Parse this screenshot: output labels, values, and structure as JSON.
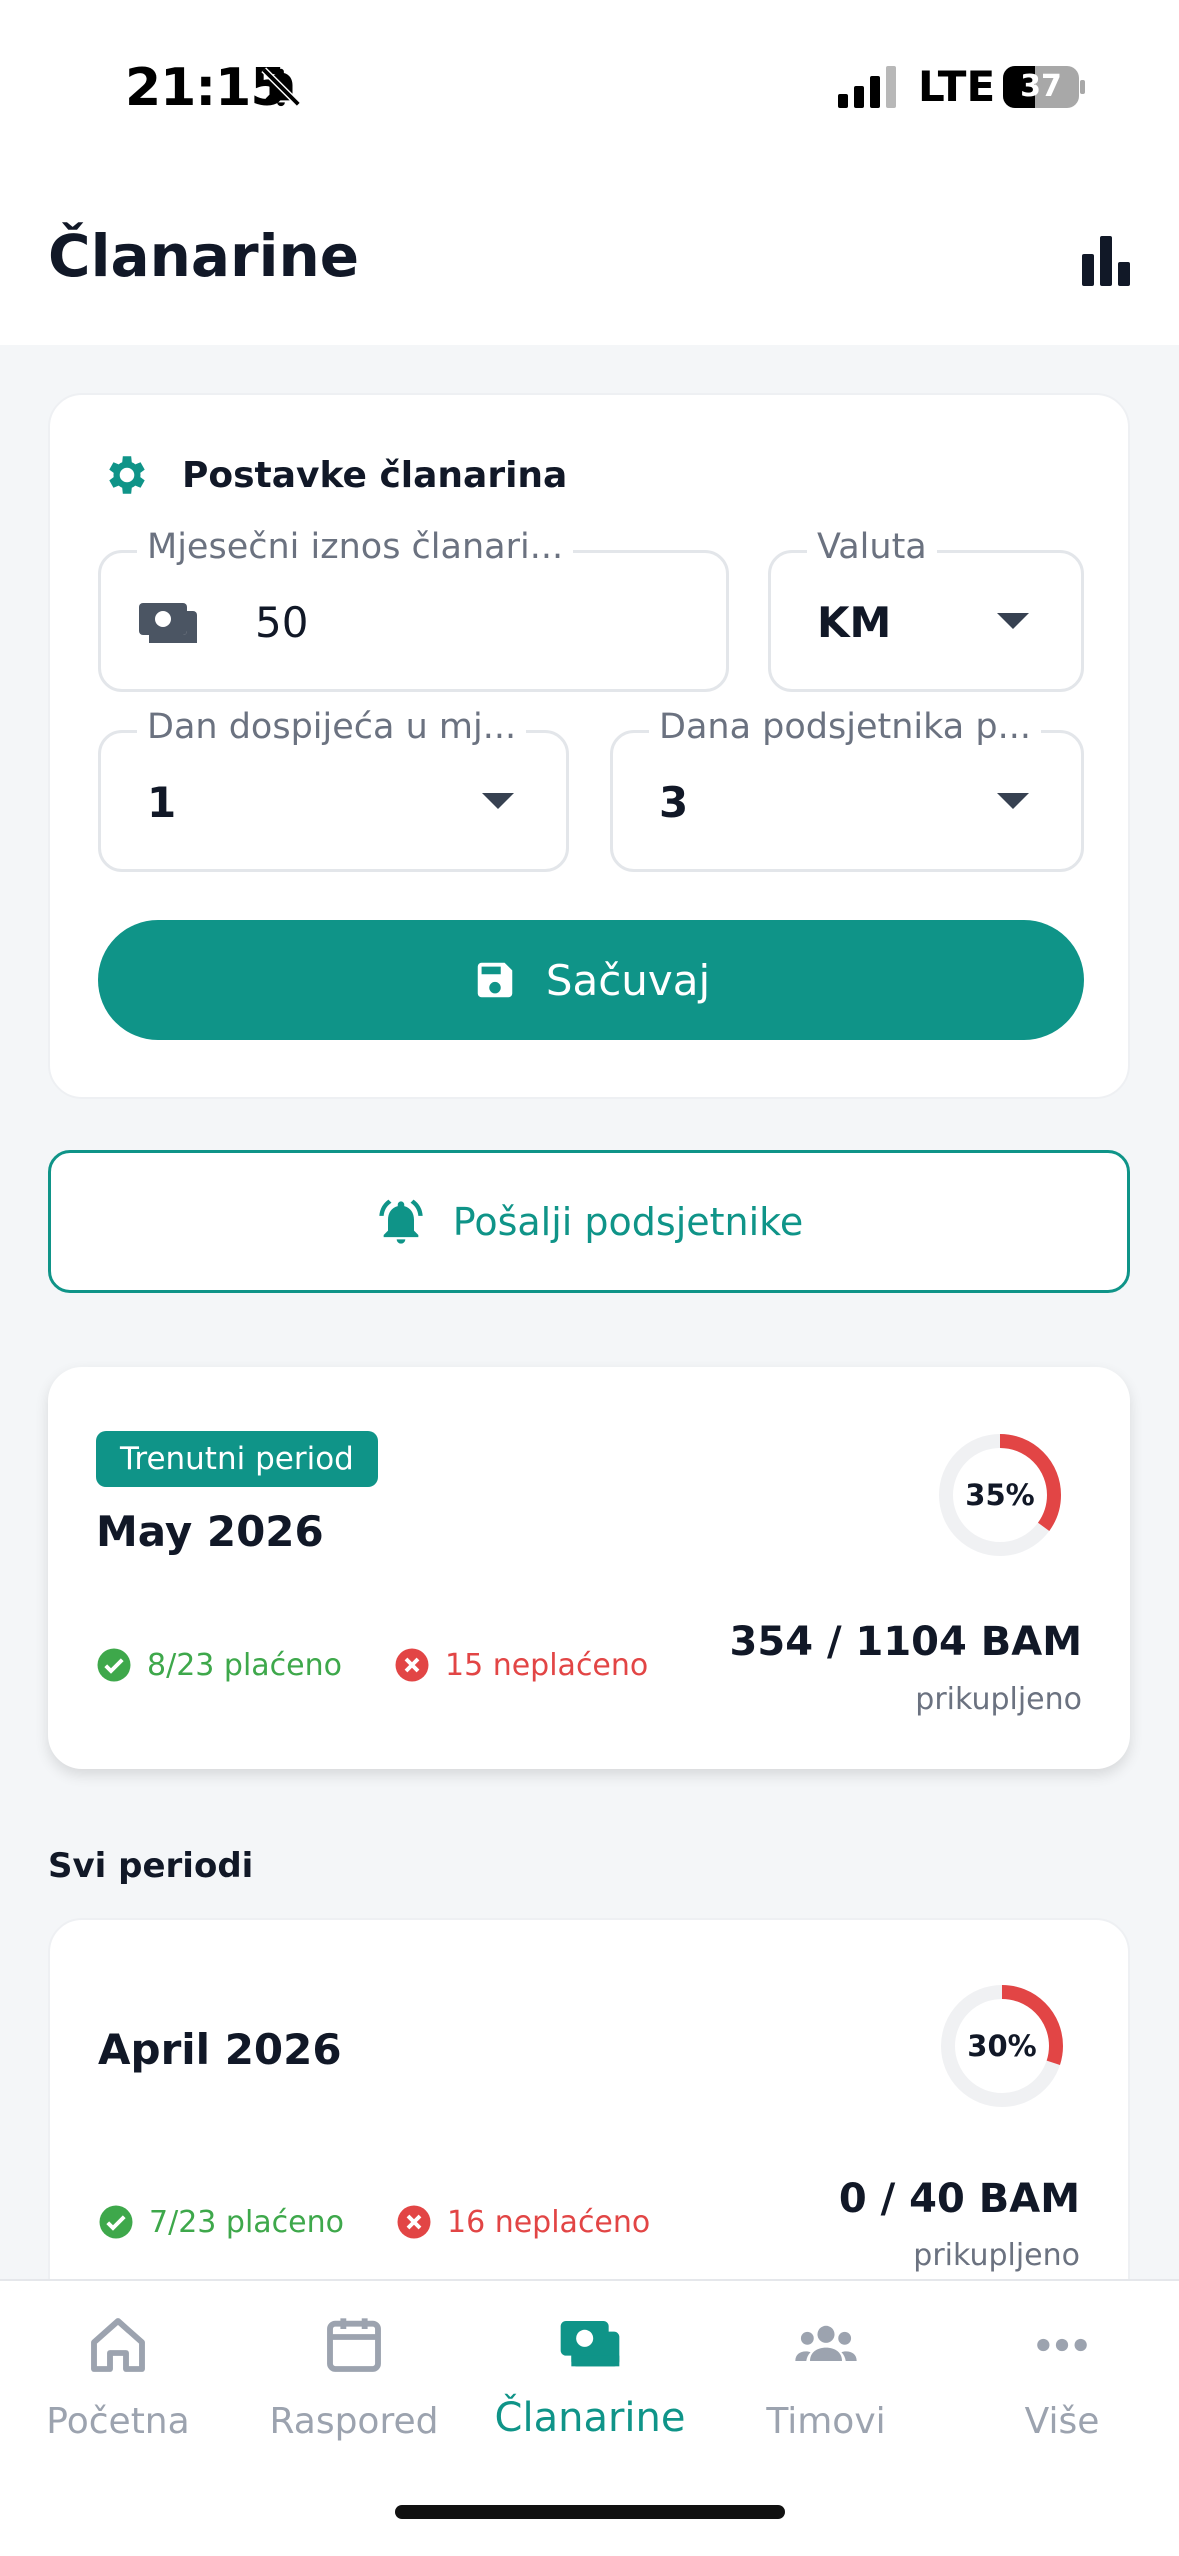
{
  "status_bar": {
    "time": "21:15",
    "network": "LTE",
    "battery": "37"
  },
  "header": {
    "title": "Članarine"
  },
  "settings": {
    "heading": "Postavke članarina",
    "monthly_amount": {
      "label": "Mjesečni iznos članari...",
      "value": "50"
    },
    "currency": {
      "label": "Valuta",
      "value": "KM"
    },
    "due_day": {
      "label": "Dan dospijeća u mj...",
      "value": "1"
    },
    "reminder_days": {
      "label": "Dana podsjetnika p...",
      "value": "3"
    },
    "save_label": "Sačuvaj"
  },
  "reminder_button": {
    "label": "Pošalji podsjetnike"
  },
  "current_period": {
    "badge": "Trenutni period",
    "title": "May 2026",
    "percent_label": "35%",
    "percent": 0.35,
    "paid": "8/23 plaćeno",
    "unpaid": "15 neplaćeno",
    "amount": "354 / 1104 BAM",
    "collected_label": "prikupljeno"
  },
  "all_periods": {
    "title": "Svi periodi",
    "items": [
      {
        "title": "April 2026",
        "percent_label": "30%",
        "percent": 0.3,
        "paid": "7/23 plaćeno",
        "unpaid": "16 neplaćeno",
        "amount": "0 / 40 BAM",
        "collected_label": "prikupljeno"
      }
    ]
  },
  "nav": {
    "items": [
      {
        "label": "Početna",
        "icon": "home-icon"
      },
      {
        "label": "Raspored",
        "icon": "calendar-icon"
      },
      {
        "label": "Članarine",
        "icon": "money-icon",
        "active": true
      },
      {
        "label": "Timovi",
        "icon": "group-icon"
      },
      {
        "label": "Više",
        "icon": "more-icon"
      }
    ]
  },
  "colors": {
    "accent": "#0f9488",
    "paid": "#3ea84b",
    "unpaid": "#e24545"
  }
}
